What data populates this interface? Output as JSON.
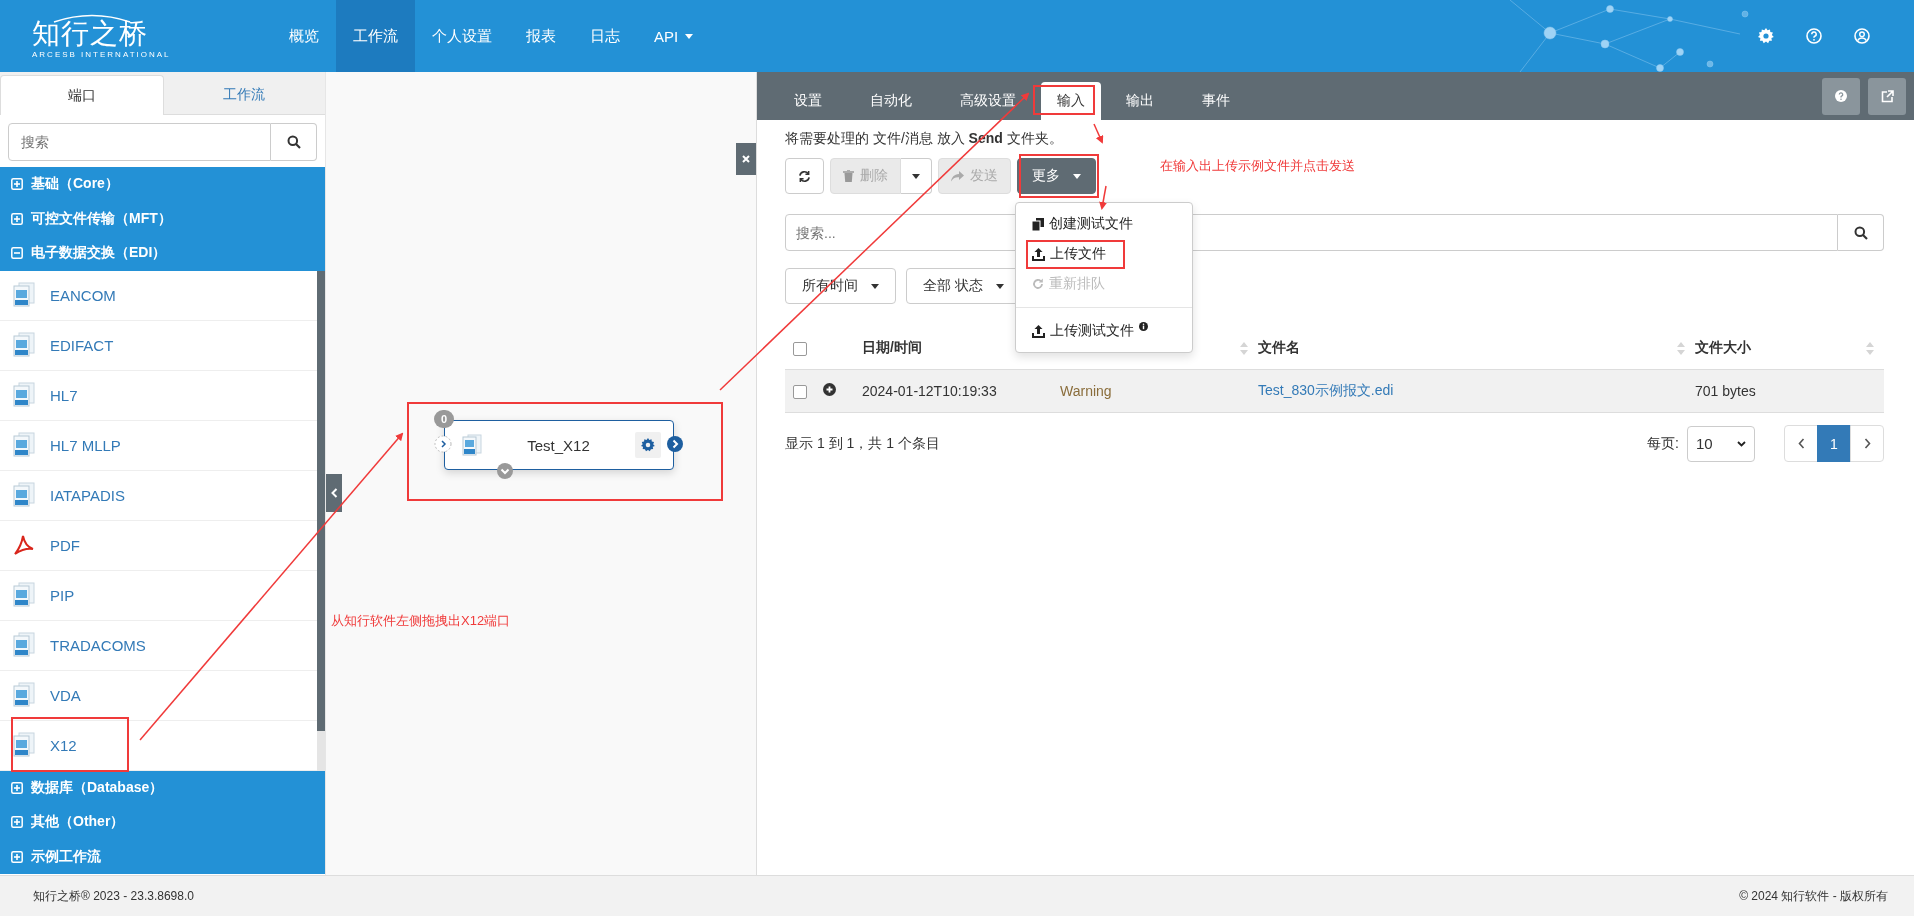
{
  "header": {
    "logo": {
      "name": "知行之桥",
      "subtitle": "ARCESB INTERNATIONAL"
    },
    "nav": [
      {
        "label": "概览",
        "selected": false,
        "dropdown": false
      },
      {
        "label": "工作流",
        "selected": true,
        "dropdown": false
      },
      {
        "label": "个人设置",
        "selected": false,
        "dropdown": false
      },
      {
        "label": "报表",
        "selected": false,
        "dropdown": false
      },
      {
        "label": "日志",
        "selected": false,
        "dropdown": false
      },
      {
        "label": "API",
        "selected": false,
        "dropdown": true
      }
    ]
  },
  "sidebar": {
    "tabs": [
      {
        "label": "端口",
        "selected": true
      },
      {
        "label": "工作流",
        "selected": false
      }
    ],
    "search": {
      "placeholder": "搜索"
    },
    "groups": [
      {
        "label": "基础（Core）",
        "expanded": false
      },
      {
        "label": "可控文件传输（MFT）",
        "expanded": false
      },
      {
        "label": "电子数据交换（EDI）",
        "expanded": true,
        "children": [
          {
            "label": "EANCOM"
          },
          {
            "label": "EDIFACT"
          },
          {
            "label": "HL7"
          },
          {
            "label": "HL7 MLLP"
          },
          {
            "label": "IATAPADIS"
          },
          {
            "label": "PDF"
          },
          {
            "label": "PIP"
          },
          {
            "label": "TRADACOMS"
          },
          {
            "label": "VDA"
          },
          {
            "label": "X12"
          }
        ]
      },
      {
        "label": "数据库（Database）",
        "expanded": false
      },
      {
        "label": "其他（Other）",
        "expanded": false
      },
      {
        "label": "示例工作流",
        "expanded": false
      }
    ]
  },
  "canvas": {
    "node": {
      "title": "Test_X12",
      "badge": "0"
    }
  },
  "panel": {
    "tabs": [
      {
        "label": "设置",
        "selected": false
      },
      {
        "label": "自动化",
        "selected": false
      },
      {
        "label": "高级设置",
        "selected": false
      },
      {
        "label": "输入",
        "selected": true
      },
      {
        "label": "输出",
        "selected": false
      },
      {
        "label": "事件",
        "selected": false
      }
    ],
    "info": "将需要处理的 文件/消息 放入 **Send** 文件夹。",
    "toolbar": [
      {
        "kind": "refresh",
        "disabled": false
      },
      {
        "kind": "split",
        "label": "删除",
        "disabled": true
      },
      {
        "kind": "send",
        "label": "发送",
        "disabled": true
      }
    ],
    "more_menu": {
      "label": "更多",
      "items": [
        {
          "label": "创建测试文件",
          "disabled": false,
          "separated": false,
          "info": false
        },
        {
          "label": "上传文件",
          "disabled": false,
          "separated": false,
          "info": false
        },
        {
          "label": "重新排队",
          "disabled": true,
          "separated": false,
          "info": false
        },
        {
          "label": "上传测试文件",
          "disabled": false,
          "separated": true,
          "info": true
        }
      ]
    },
    "search": {
      "placeholder": "搜索..."
    },
    "filters": [
      "所有时间",
      "全部 状态"
    ],
    "table": {
      "all_checked": false,
      "columns": [
        {
          "label": "日期/时间"
        },
        {
          "sortable": true
        },
        {
          "label": "文件名",
          "sortable": true
        },
        {
          "label": "文件大小",
          "sortable": true
        }
      ],
      "rows": [
        {
          "checked": false,
          "date": "2024-01-12T10:19:33",
          "status": "Warning",
          "file": "Test_830示例报文.edi",
          "size": "701 bytes"
        }
      ]
    },
    "summary": "显示 1 到 1，共 1 个条目",
    "page_size": {
      "label": "每页:",
      "value": "10"
    },
    "pager": [
      {
        "label": "1",
        "selected": true
      }
    ]
  },
  "footer": {
    "left": "知行之桥® 2023 - 23.3.8698.0",
    "right": "© 2024 知行软件 - 版权所有"
  },
  "annotations": [
    {
      "text": "在输入出上传示例文件并点击发送"
    },
    {
      "text": "从知行软件左侧拖拽出X12端口"
    }
  ]
}
